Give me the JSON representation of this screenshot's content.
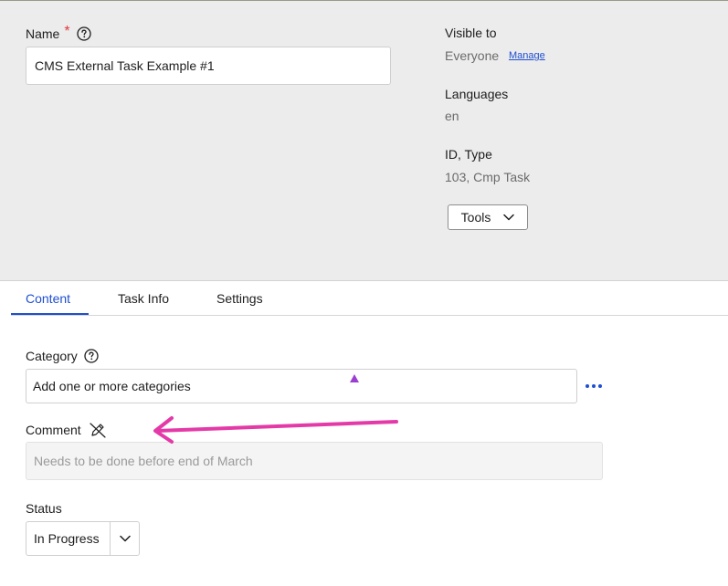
{
  "header": {
    "name_label": "Name",
    "required_mark": "*",
    "name_value": "CMS External Task Example #1",
    "visible_to_label": "Visible to",
    "visible_to_value": "Everyone",
    "manage_link": "Manage",
    "languages_label": "Languages",
    "languages_value": "en",
    "id_type_label": "ID, Type",
    "id_type_value": "103, Cmp Task",
    "tools_button": "Tools"
  },
  "tabs": [
    {
      "label": "Content",
      "active": true
    },
    {
      "label": "Task Info",
      "active": false
    },
    {
      "label": "Settings",
      "active": false
    }
  ],
  "form": {
    "category_label": "Category",
    "category_value": "Add one or more categories",
    "comment_label": "Comment",
    "comment_value": "Needs to be done before end of March",
    "status_label": "Status",
    "status_value": "In Progress"
  },
  "colors": {
    "accent": "#1f4fd1",
    "required": "#e0393e",
    "annotation_arrow": "#e43aa8",
    "header_bg": "#ececec"
  },
  "icons": [
    "help-icon",
    "chevron-down-icon",
    "more-icon",
    "edit-off-icon",
    "annotation-arrow"
  ]
}
